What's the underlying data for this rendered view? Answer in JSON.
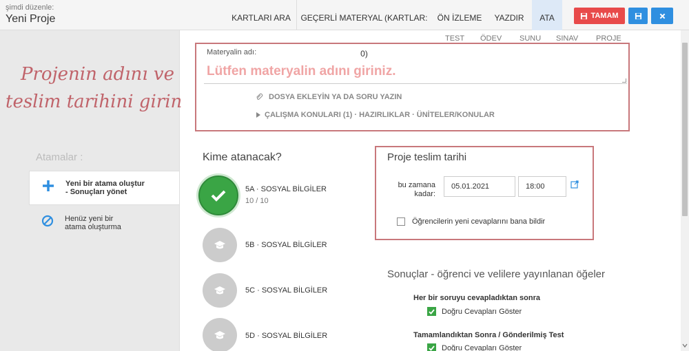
{
  "header": {
    "edit_label": "şimdi düzenle:",
    "title": "Yeni Proje",
    "nav": [
      "KARTLARI ARA",
      "GEÇERLİ MATERYAL (KARTLAR: 0)",
      "ÖN İZLEME",
      "YAZDIR",
      "ATA"
    ],
    "active_nav": "ATA",
    "done_label": "TAMAM"
  },
  "subtabs": [
    "TEST",
    "ÖDEV",
    "SUNU",
    "SINAV",
    "PROJE"
  ],
  "annotation": [
    "Projenin adını ve",
    "teslim tarihini girin"
  ],
  "material": {
    "label": "Materyalin adı:",
    "placeholder": "Lütfen materyalin adını giriniz.",
    "attach": "DOSYA EKLEYİN YA DA SORU YAZIN",
    "topics": "ÇALIŞMA KONULARI (1) · HAZIRLIKLAR · ÜNİTELER/KONULAR"
  },
  "assignments": {
    "heading": "Atamalar :",
    "items": [
      {
        "title": "Yeni bir atama oluştur",
        "sub": "- Sonuçları yönet"
      },
      {
        "title": "Henüz yeni bir",
        "sub": "atama oluşturma"
      }
    ]
  },
  "classes": {
    "heading": "Kime atanacak?",
    "list": [
      {
        "name": "5A · SOSYAL BİLGİLER",
        "count": "10 / 10"
      },
      {
        "name": "5B · SOSYAL BİLGİLER"
      },
      {
        "name": "5C · SOSYAL BİLGİLER"
      },
      {
        "name": "5D · SOSYAL BİLGİLER"
      }
    ]
  },
  "due": {
    "title": "Proje teslim tarihi",
    "label": "bu zamana kadar:",
    "date": "05.01.2021",
    "time": "18:00",
    "notify": "Öğrencilerin yeni cevaplarını bana bildir"
  },
  "results": {
    "title": "Sonuçlar - öğrenci ve velilere yayınlanan öğeler",
    "after_each": "Her bir soruyu cevapladıktan sonra",
    "after_each_option": "Doğru Cevapları Göster",
    "after_done": "Tamamlandıktan Sonra / Gönderilmiş Test",
    "after_done_option": "Doğru Cevapları Göster"
  },
  "colors": {
    "accent_red": "#e84a4a",
    "accent_blue": "#2f8fe0",
    "selected_green": "#3aa545",
    "annotation": "#c0636a"
  }
}
